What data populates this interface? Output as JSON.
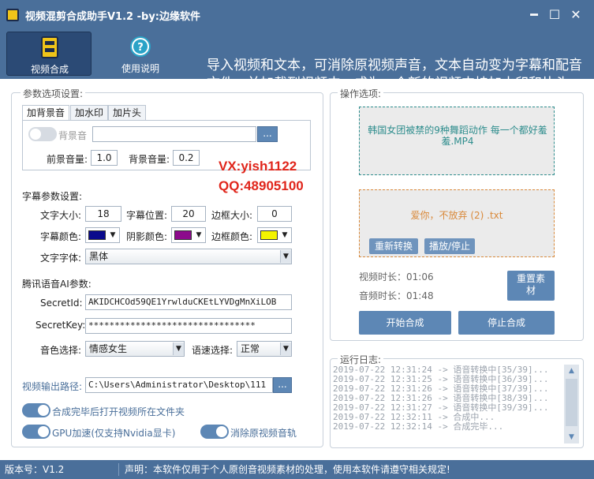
{
  "window": {
    "title": "视频混剪合成助手V1.2 -by:边缘软件",
    "min_glyph": "━",
    "max_glyph": "☐",
    "close_glyph": "✕"
  },
  "ribbon": {
    "compose_label": "视频合成",
    "help_label": "使用说明",
    "intro": "导入视频和文本，可消除原视频声音，文本自动变为字幕和配音文件，并加载到视频中，成为一个新的视频支持加水印和片头"
  },
  "params": {
    "legend": "参数选项设置:",
    "tabs": [
      "加背景音",
      "加水印",
      "加片头"
    ],
    "bgm_label": "背景音",
    "bgm_path": "",
    "browse_label": "...",
    "fg_volume_label": "前景音量:",
    "fg_volume": "1.0",
    "bg_volume_label": "背景音量:",
    "bg_volume": "0.2",
    "subtitle_legend": "字幕参数设置:",
    "font_size_label": "文字大小:",
    "font_size": "18",
    "sub_pos_label": "字幕位置:",
    "sub_pos": "20",
    "border_size_label": "边框大小:",
    "border_size": "0",
    "sub_color_label": "字幕颜色:",
    "shadow_color_label": "阴影颜色:",
    "border_color_label": "边框颜色:",
    "font_label": "文字字体:",
    "font_value": "黑体",
    "tts_legend": "腾讯语音AI参数:",
    "secret_id_label": "SecretId:",
    "secret_id": "AKIDCHCOd59QE1YrwlduCKEtLYVDgMnXiLOB",
    "secret_key_label": "SecretKey:",
    "secret_key": "********************************",
    "voice_label": "音色选择:",
    "voice_value": "情感女生",
    "speed_label": "语速选择:",
    "speed_value": "正常",
    "output_label": "视频输出路径:",
    "output_path": "C:\\Users\\Administrator\\Desktop\\111",
    "open_folder_label": "合成完毕后打开视频所在文件夹",
    "gpu_label": "GPU加速(仅支持Nvidia显卡)",
    "remove_audio_label": "消除原视频音轨"
  },
  "contact": {
    "vx": "VX:yish1122",
    "qq": "QQ:48905100"
  },
  "colors": {
    "subtitle": "#0a0a8c",
    "shadow": "#8c0a8c",
    "border": "#f4f400"
  },
  "ops": {
    "legend": "操作选项:",
    "video_file": "韩国女团被禁的9种舞蹈动作 每一个都好羞羞.MP4",
    "text_file": "爱你，不放弃 (2) .txt",
    "reconvert_label": "重新转换",
    "play_label": "播放/停止",
    "video_duration_label": "视频时长：",
    "video_duration": "01:06",
    "audio_duration_label": "音频时长：",
    "audio_duration": "01:48",
    "reset_label": "重置素材",
    "start_label": "开始合成",
    "stop_label": "停止合成"
  },
  "log": {
    "legend": "运行日志:",
    "lines": [
      "2019-07-22 12:31:24 -> 语音转换中[35/39]...",
      "2019-07-22 12:31:25 -> 语音转换中[36/39]...",
      "2019-07-22 12:31:26 -> 语音转换中[37/39]...",
      "2019-07-22 12:31:26 -> 语音转换中[38/39]...",
      "2019-07-22 12:31:27 -> 语音转换中[39/39]...",
      "2019-07-22 12:32:11 -> 合成中...",
      "2019-07-22 12:32:14 -> 合成完毕..."
    ]
  },
  "status": {
    "version": "版本号：V1.2",
    "notice": "声明：本软件仅用于个人原创音视频素材的处理，使用本软件请遵守相关规定!"
  }
}
